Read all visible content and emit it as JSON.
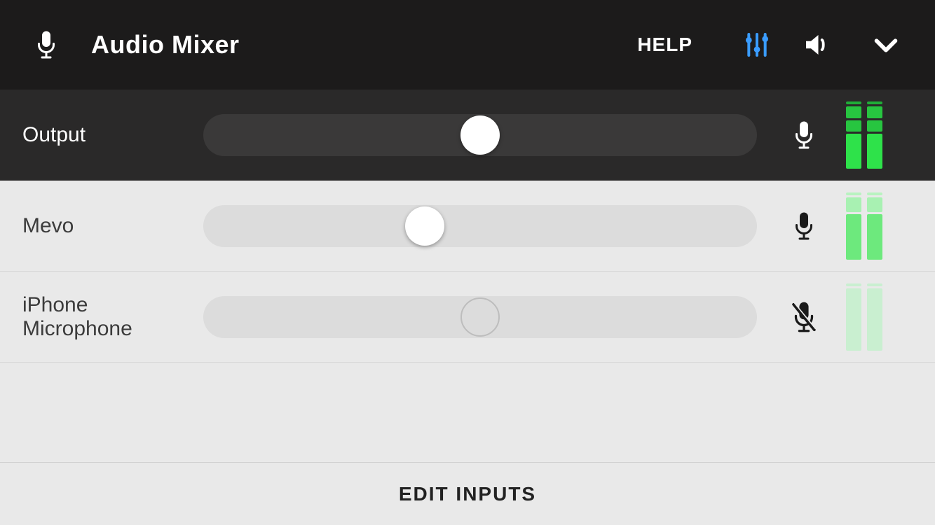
{
  "header": {
    "title": "Audio Mixer",
    "help_label": "HELP"
  },
  "channels": {
    "output": {
      "label": "Output",
      "slider_percent": 50,
      "muted": false,
      "meter_level": 0.75
    },
    "inputs": [
      {
        "label": "Mevo",
        "slider_percent": 40,
        "muted": false,
        "meter_level": 0.6
      },
      {
        "label": "iPhone Microphone",
        "slider_percent": 50,
        "muted": true,
        "meter_level": 0.4
      }
    ]
  },
  "footer": {
    "edit_inputs_label": "EDIT INPUTS"
  },
  "colors": {
    "header_bg": "#1c1b1b",
    "output_bg": "#2a2929",
    "input_bg": "#e9e9e9",
    "accent_blue": "#3a9cff",
    "meter_green": "#2ee24a"
  }
}
